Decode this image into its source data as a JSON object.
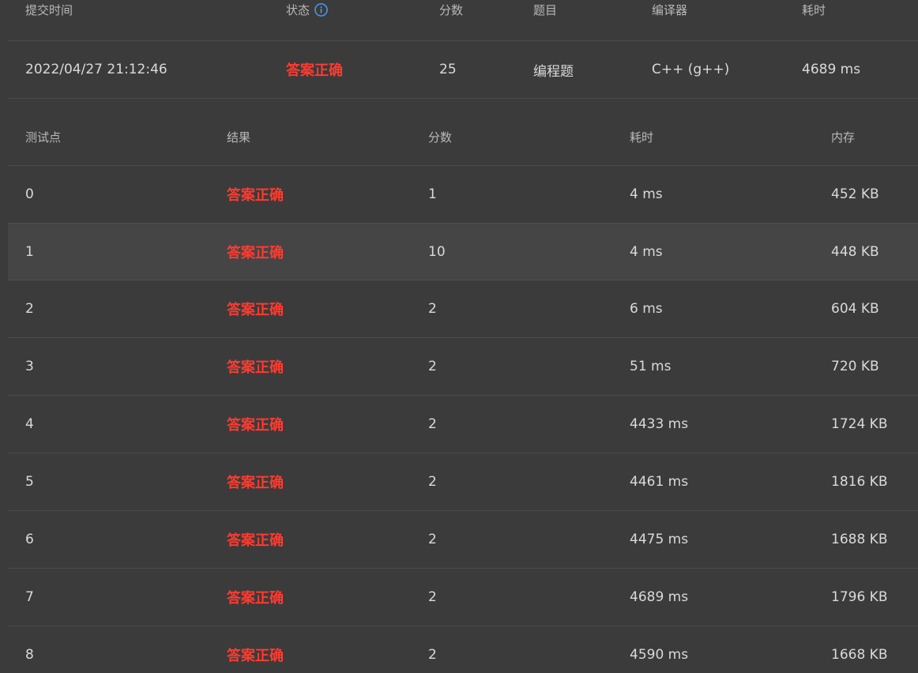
{
  "summary": {
    "headers": {
      "submit_time": "提交时间",
      "status": "状态",
      "score": "分数",
      "problem": "题目",
      "compiler": "编译器",
      "time": "耗时"
    },
    "row": {
      "submit_time": "2022/04/27 21:12:46",
      "status": "答案正确",
      "score": "25",
      "problem": "编程题",
      "compiler": "C++ (g++)",
      "time": "4689 ms"
    }
  },
  "cases": {
    "headers": {
      "test_point": "测试点",
      "result": "结果",
      "score": "分数",
      "time": "耗时",
      "memory": "内存"
    },
    "rows": [
      {
        "id": "0",
        "result": "答案正确",
        "score": "1",
        "time": "4 ms",
        "memory": "452 KB"
      },
      {
        "id": "1",
        "result": "答案正确",
        "score": "10",
        "time": "4 ms",
        "memory": "448 KB"
      },
      {
        "id": "2",
        "result": "答案正确",
        "score": "2",
        "time": "6 ms",
        "memory": "604 KB"
      },
      {
        "id": "3",
        "result": "答案正确",
        "score": "2",
        "time": "51 ms",
        "memory": "720 KB"
      },
      {
        "id": "4",
        "result": "答案正确",
        "score": "2",
        "time": "4433 ms",
        "memory": "1724 KB"
      },
      {
        "id": "5",
        "result": "答案正确",
        "score": "2",
        "time": "4461 ms",
        "memory": "1816 KB"
      },
      {
        "id": "6",
        "result": "答案正确",
        "score": "2",
        "time": "4475 ms",
        "memory": "1688 KB"
      },
      {
        "id": "7",
        "result": "答案正确",
        "score": "2",
        "time": "4689 ms",
        "memory": "1796 KB"
      },
      {
        "id": "8",
        "result": "答案正确",
        "score": "2",
        "time": "4590 ms",
        "memory": "1668 KB"
      }
    ]
  },
  "colors": {
    "background": "#3b3b3b",
    "accepted": "#ff3b30",
    "info_icon": "#4a9cf0",
    "highlight_row": "#454545"
  },
  "icons": {
    "status_info": "info-icon"
  }
}
